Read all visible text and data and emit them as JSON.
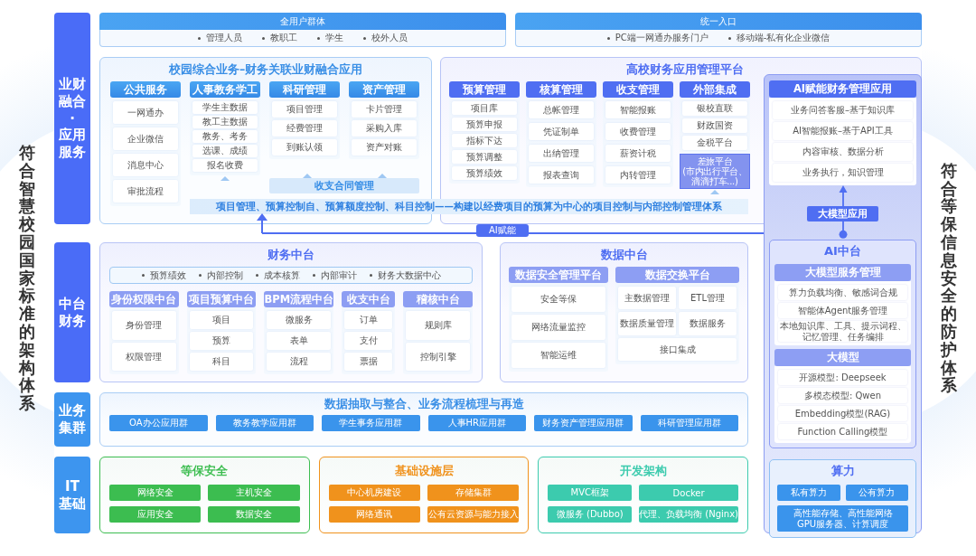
{
  "side_labels": {
    "left": "符合智慧校园国家标准的架构体系",
    "right": "符合等保信息安全的防护体系"
  },
  "layers": [
    {
      "lines": [
        "业财",
        "融合",
        "·",
        "应用",
        "服务"
      ],
      "color": "#4a6cf7"
    },
    {
      "lines": [
        "中台",
        "财务"
      ],
      "color": "#4a6cf7"
    },
    {
      "lines": [
        "业务",
        "集群"
      ],
      "color": "#3d95ef"
    },
    {
      "lines": [
        "IT",
        "基础"
      ],
      "color": "#3d95ef"
    }
  ],
  "user_groups": {
    "title": "全用户群体",
    "items": [
      "管理人员",
      "教职工",
      "学生",
      "校外人员"
    ]
  },
  "entry": {
    "title": "统一入口",
    "items": [
      "PC端一网通办服务门户",
      "移动端-私有化企业微信"
    ]
  },
  "campus_apps": {
    "title": "校园综合业务–财务关联业财融合应用",
    "columns": [
      {
        "title": "公共服务",
        "items": [
          "一网通办",
          "企业微信",
          "消息中心",
          "审批流程"
        ]
      },
      {
        "title": "人事教务学工",
        "items": [
          "学生主数据",
          "教工主数据",
          "教务、考务",
          "选课、成绩",
          "报名收费"
        ]
      },
      {
        "title": "科研管理",
        "items": [
          "项目管理",
          "经费管理",
          "到账认领"
        ]
      },
      {
        "title": "资产管理",
        "items": [
          "卡片管理",
          "采购入库",
          "资产对账"
        ]
      }
    ],
    "contract": "收支合同管理"
  },
  "control_bar": "项目管理、预算控制自、预算额度控制、科目控制——构建以经费项目的预算为中心的项目控制与内部控制管理体系",
  "ai_link": "AI赋能",
  "finance_platform": {
    "title": "高校财务应用管理平台",
    "columns": [
      {
        "title": "预算管理",
        "items": [
          "项目库",
          "预算申报",
          "指标下达",
          "预算调整",
          "预算绩效"
        ]
      },
      {
        "title": "核算管理",
        "items": [
          "总帐管理",
          "凭证制单",
          "出纳管理",
          "报表查询"
        ]
      },
      {
        "title": "收支管理",
        "items": [
          "智能报账",
          "收费管理",
          "薪资计税",
          "内转管理"
        ]
      },
      {
        "title": "外部集成",
        "items": [
          "银校直联",
          "财政国资",
          "金税平台"
        ]
      }
    ],
    "travel": {
      "lines": [
        "差旅平台",
        "(市内出行平台、",
        "滴滴打车...)"
      ]
    }
  },
  "ai_apps": {
    "title": "AI赋能财务管理应用",
    "items": [
      "业务问答客服–基于知识库",
      "AI智能报账–基于API工具",
      "内容审核、数据分析",
      "业务执行，知识管理"
    ]
  },
  "model_app": "大模型应用",
  "ai_platform": {
    "title": "AI中台",
    "groups": [
      {
        "title": "大模型服务管理",
        "items": [
          "算力负载均衡、敏感词合规",
          "智能体Agent服务管理",
          "本地知识库、工具、提示词程、记忆管理、任务编排"
        ]
      },
      {
        "title": "大模型",
        "items": [
          "开源模型: Deepseek",
          "多模态模型: Qwen",
          "Embedding模型(RAG)",
          "Function Calling模型"
        ]
      }
    ]
  },
  "compute": {
    "title": "算力",
    "items": [
      "私有算力",
      "公有算力"
    ],
    "infra": {
      "lines": [
        "高性能存储、高性能网络",
        "GPU服务器、计算调度"
      ]
    }
  },
  "finance_center": {
    "title": "财务中台",
    "capabilities": [
      "预算绩效",
      "内部控制",
      "成本核算",
      "内部审计",
      "财务大数据中心"
    ],
    "columns": [
      {
        "title": "身份权限中台",
        "items": [
          "身份管理",
          "权限管理"
        ]
      },
      {
        "title": "项目预算中台",
        "items": [
          "项目",
          "预算",
          "科目"
        ]
      },
      {
        "title": "BPM流程中台",
        "items": [
          "微服务",
          "表单",
          "流程"
        ]
      },
      {
        "title": "收支中台",
        "items": [
          "订单",
          "支付",
          "票据"
        ]
      },
      {
        "title": "稽核中台",
        "items": [
          "规则库",
          "控制引擎"
        ]
      }
    ]
  },
  "data_center": {
    "title": "数据中台",
    "security": {
      "title": "数据安全管理平台",
      "items": [
        "安全等保",
        "网络流量监控",
        "智能运维"
      ]
    },
    "exchange": {
      "title": "数据交换平台",
      "items": [
        "主数据管理",
        "ETL管理",
        "数据质量管理",
        "数据服务",
        "接口集成"
      ]
    }
  },
  "clusters": {
    "title": "数据抽取与整合、业务流程梳理与再造",
    "items": [
      "OA办公应用群",
      "教务教学应用群",
      "学生事务应用群",
      "人事HR应用群",
      "财务资产管理应用群",
      "科研管理应用群"
    ]
  },
  "it_base": [
    {
      "title": "等保安全",
      "color": "#3cbd50",
      "items": [
        "网络安全",
        "主机安全",
        "应用安全",
        "数据安全"
      ]
    },
    {
      "title": "基础设施层",
      "color": "#f0921c",
      "items": [
        "中心机房建设",
        "存储集群",
        "网络通讯",
        "公有云资源与能力接入"
      ]
    },
    {
      "title": "开发架构",
      "color": "#3ccbae",
      "items": [
        "MVC框架",
        "Docker",
        "微服务 (Dubbo)",
        "代理、负载均衡 (Nginx)"
      ]
    }
  ]
}
